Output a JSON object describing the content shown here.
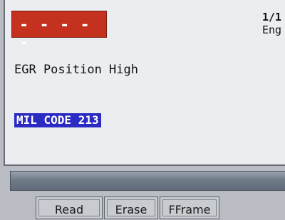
{
  "code_box": {
    "text": "- - - - -",
    "color": "#c4321f"
  },
  "header": {
    "page": "1/1",
    "system": "Eng"
  },
  "description": "EGR Position High",
  "mil_code": {
    "text": "MIL CODE 213",
    "highlight_color": "#2b2bc4"
  },
  "softkeys": [
    {
      "label": ""
    },
    {
      "label": "Read"
    },
    {
      "label": "Erase"
    },
    {
      "label": "FFrame"
    }
  ]
}
